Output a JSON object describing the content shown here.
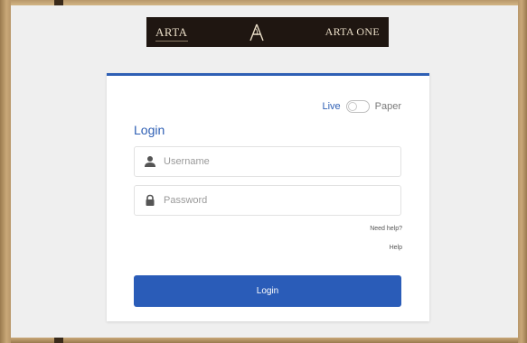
{
  "brand": {
    "left_text": "ARTA",
    "right_text": "ARTA ONE",
    "logo_icon": "arta-a-monogram-icon"
  },
  "mode_toggle": {
    "live_label": "Live",
    "paper_label": "Paper",
    "selected": "Live"
  },
  "login_form": {
    "heading": "Login",
    "username": {
      "placeholder": "Username",
      "value": "",
      "icon": "user-icon"
    },
    "password": {
      "placeholder": "Password",
      "value": "",
      "icon": "lock-icon"
    },
    "need_help_label": "Need help?",
    "help_label": "Help",
    "submit_label": "Login"
  },
  "colors": {
    "accent": "#2e5fb4",
    "button": "#2a5cb8",
    "banner": "#1f1611",
    "background": "#efefef"
  }
}
